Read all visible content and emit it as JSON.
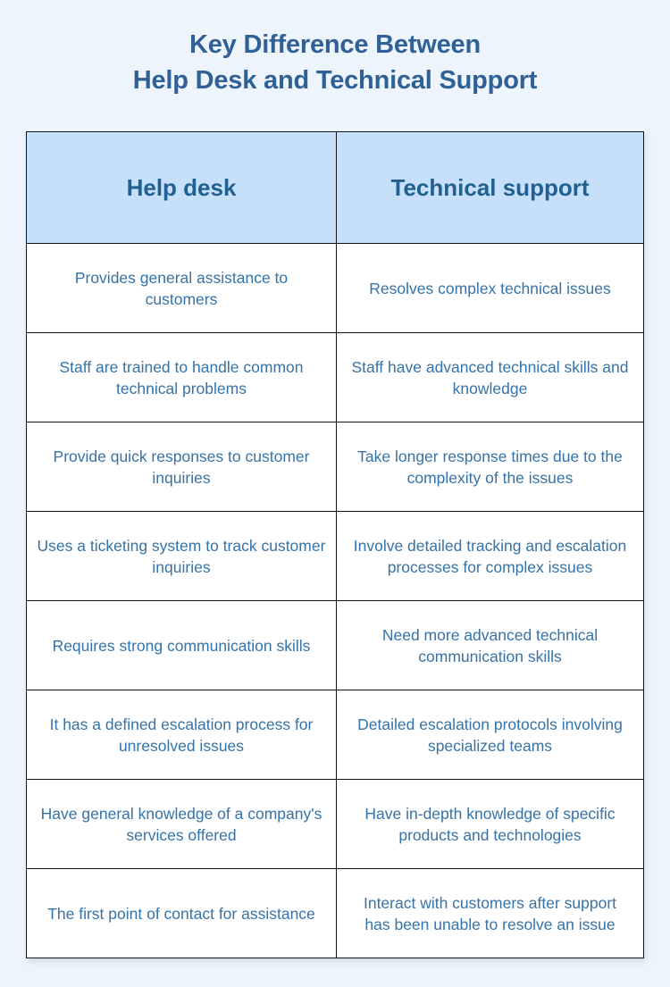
{
  "colors": {
    "page_background": "#EDF4FC",
    "title_text": "#2F6096",
    "header_background": "#C6DFFB",
    "header_text": "#22618F",
    "cell_text": "#3573A8",
    "border": "#111418",
    "cell_background": "#FFFFFF"
  },
  "title": {
    "line1": "Key Difference Between",
    "line2": "Help Desk and Technical Support"
  },
  "table": {
    "headers": [
      "Help desk",
      "Technical support"
    ],
    "rows": [
      {
        "help_desk": "Provides general assistance to customers",
        "technical_support": "Resolves complex technical issues"
      },
      {
        "help_desk": "Staff are trained to handle common technical problems",
        "technical_support": "Staff have advanced technical skills and knowledge"
      },
      {
        "help_desk": "Provide quick responses to customer inquiries",
        "technical_support": "Take longer response times due to the complexity of the issues"
      },
      {
        "help_desk": "Uses a ticketing system to track customer inquiries",
        "technical_support": "Involve detailed tracking and escalation processes for complex issues"
      },
      {
        "help_desk": "Requires strong communication skills",
        "technical_support": "Need more advanced technical communication skills"
      },
      {
        "help_desk": "It has a defined escalation process for unresolved issues",
        "technical_support": "Detailed escalation protocols involving specialized teams"
      },
      {
        "help_desk": "Have general knowledge of a company's services offered",
        "technical_support": "Have in-depth knowledge of specific products and technologies"
      },
      {
        "help_desk": "The first point of contact for assistance",
        "technical_support": "Interact with customers after support has been unable to resolve an issue"
      }
    ]
  }
}
